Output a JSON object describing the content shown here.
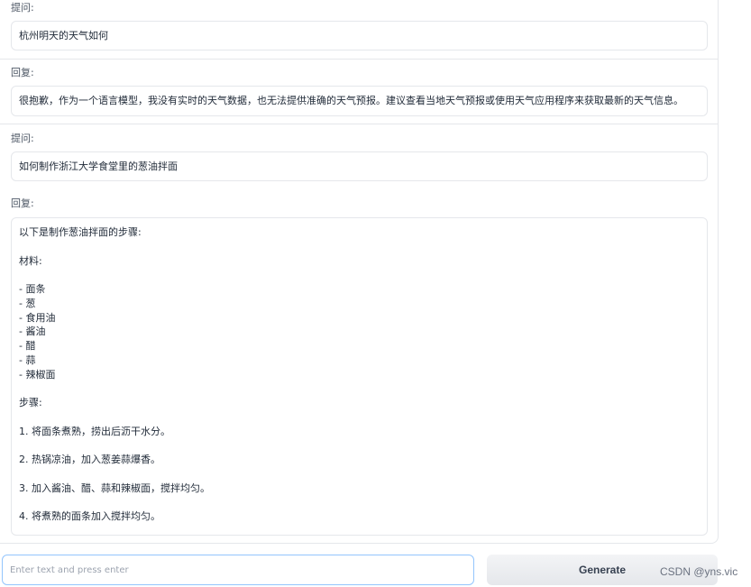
{
  "conversation": [
    {
      "role_label": "提问:",
      "text": "杭州明天的天气如何"
    },
    {
      "role_label": "回复:",
      "text": "很抱歉，作为一个语言模型，我没有实时的天气数据，也无法提供准确的天气预报。建议查看当地天气预报或使用天气应用程序来获取最新的天气信息。"
    },
    {
      "role_label": "提问:",
      "text": "如何制作浙江大学食堂里的葱油拌面"
    },
    {
      "role_label": "回复:",
      "lines": [
        "以下是制作葱油拌面的步骤:",
        "",
        "材料:",
        "",
        "- 面条",
        "- 葱",
        "- 食用油",
        "- 酱油",
        "- 醋",
        "- 蒜",
        "- 辣椒面",
        "",
        "步骤:",
        "",
        "1. 将面条煮熟，捞出后沥干水分。",
        "",
        "2. 热锅凉油，加入葱姜蒜爆香。",
        "",
        "3. 加入酱油、醋、蒜和辣椒面，搅拌均匀。",
        "",
        "4. 将煮熟的面条加入搅拌均匀。"
      ]
    }
  ],
  "input": {
    "placeholder": "Enter text and press enter",
    "value": ""
  },
  "generate_button": {
    "label": "Generate"
  },
  "watermark": "CSDN @yns.vic"
}
